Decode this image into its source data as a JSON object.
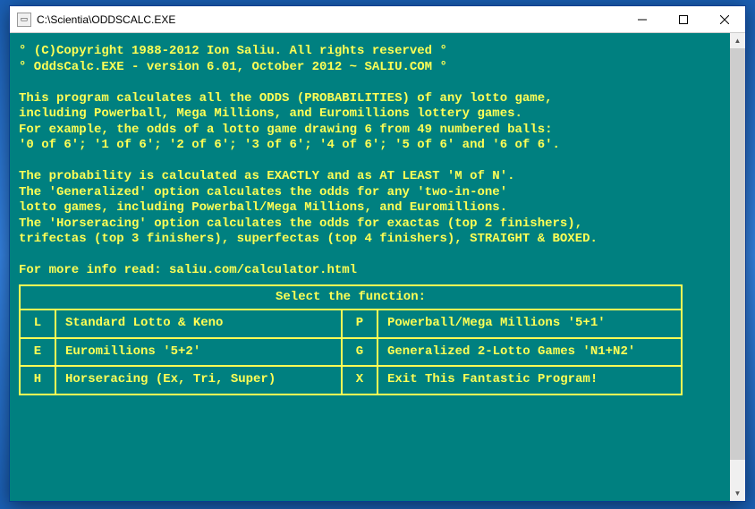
{
  "window": {
    "title": "C:\\Scientia\\ODDSCALC.EXE"
  },
  "header": {
    "line1": "° (C)Copyright 1988-2012 Ion Saliu. All rights reserved °",
    "line2": "° OddsCalc.EXE - version 6.01, October 2012 ~ SALIU.COM °"
  },
  "body": {
    "p1l1": "This program calculates all the ODDS (PROBABILITIES) of any lotto game,",
    "p1l2": "including Powerball, Mega Millions, and Euromillions lottery games.",
    "p1l3": "For example, the odds of a lotto game drawing 6 from 49 numbered balls:",
    "p1l4": "'0 of 6'; '1 of 6'; '2 of 6'; '3 of 6'; '4 of 6'; '5 of 6' and '6 of 6'.",
    "p2l1": "The probability is calculated as EXACTLY and as AT LEAST 'M of N'.",
    "p2l2": "The 'Generalized' option calculates the odds for any 'two-in-one'",
    "p2l3": "lotto games, including Powerball/Mega Millions, and Euromillions.",
    "p2l4": "The 'Horseracing' option calculates the odds for exactas (top 2 finishers),",
    "p2l5": "trifectas (top 3 finishers), superfectas (top 4 finishers), STRAIGHT & BOXED.",
    "moreinfo": "For more info read: saliu.com/calculator.html"
  },
  "menu": {
    "title": "Select the function:",
    "items": [
      {
        "key": "L",
        "desc": "Standard Lotto & Keno"
      },
      {
        "key": "P",
        "desc": "Powerball/Mega Millions '5+1'"
      },
      {
        "key": "E",
        "desc": "Euromillions '5+2'"
      },
      {
        "key": "G",
        "desc": "Generalized 2-Lotto Games 'N1+N2'"
      },
      {
        "key": "H",
        "desc": "Horseracing (Ex, Tri, Super)"
      },
      {
        "key": "X",
        "desc": "Exit This Fantastic Program!"
      }
    ]
  }
}
